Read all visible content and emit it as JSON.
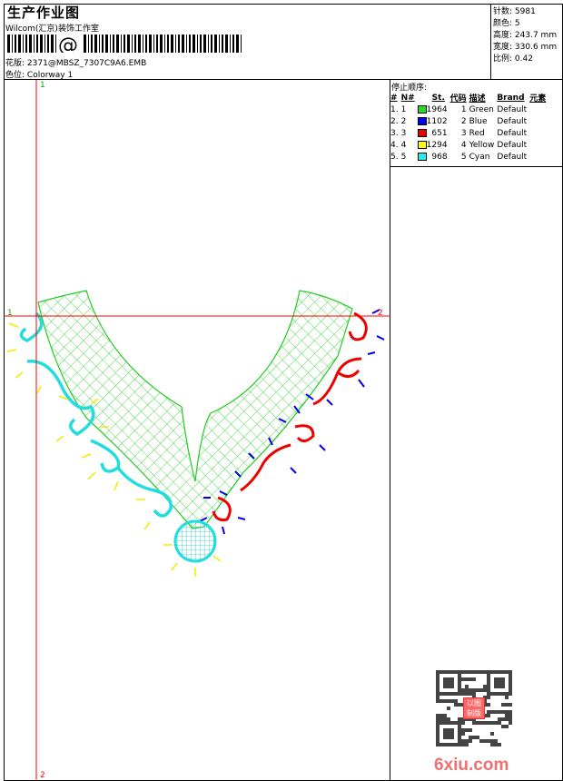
{
  "header": {
    "title": "生产作业图",
    "company": "Wilcom(汇京)装饰工作室",
    "barcode_symbol": "@",
    "pattern_label": "花版:",
    "pattern_value": "2371@MBSZ_7307C9A6.EMB",
    "colorway_label": "色位:",
    "colorway_value": "Colorway 1"
  },
  "stats": [
    {
      "label": "针数:",
      "value": "5981"
    },
    {
      "label": "颜色:",
      "value": "5"
    },
    {
      "label": "高度:",
      "value": "243.7 mm"
    },
    {
      "label": "宽度:",
      "value": "330.6 mm"
    },
    {
      "label": "比例:",
      "value": "0.42"
    }
  ],
  "stop_sequence": {
    "label": "停止顺序:",
    "headers": [
      "#",
      "N#",
      "St.",
      "代码",
      "描述",
      "Brand",
      "元素"
    ],
    "rows": [
      {
        "idx": "1.",
        "n": "1",
        "color": "#22dd22",
        "st": "1964",
        "code": "1",
        "desc": "Green",
        "brand": "Default"
      },
      {
        "idx": "2.",
        "n": "2",
        "color": "#0000ee",
        "st": "1102",
        "code": "2",
        "desc": "Blue",
        "brand": "Default"
      },
      {
        "idx": "3.",
        "n": "3",
        "color": "#ee0000",
        "st": "651",
        "code": "3",
        "desc": "Red",
        "brand": "Default"
      },
      {
        "idx": "4.",
        "n": "4",
        "color": "#ffff00",
        "st": "1294",
        "code": "4",
        "desc": "Yellow",
        "brand": "Default"
      },
      {
        "idx": "5.",
        "n": "5",
        "color": "#22eeee",
        "st": "968",
        "code": "5",
        "desc": "Cyan",
        "brand": "Default"
      }
    ]
  },
  "axes": {
    "top": "1",
    "bottom": "2",
    "left": "1",
    "right": "2"
  },
  "logos": {
    "seal": "以图制版",
    "watermark": "6xiu.com"
  }
}
